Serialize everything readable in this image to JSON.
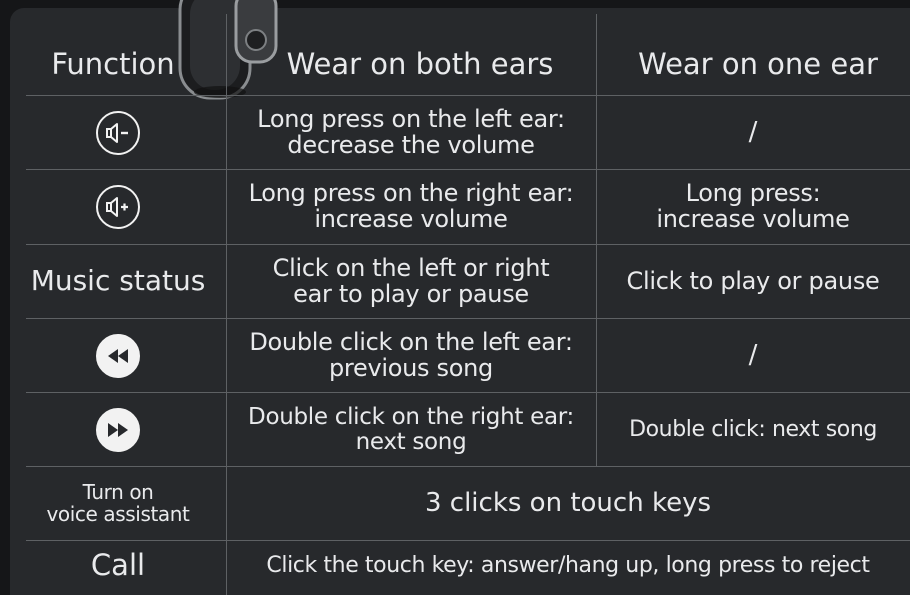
{
  "header": {
    "function": "Function",
    "both": "Wear on both ears",
    "one": "Wear on one ear"
  },
  "rows": [
    {
      "icon": "volume-down-icon",
      "both_line1": "Long press on the left ear:",
      "both_line2": "decrease the volume",
      "one": "/"
    },
    {
      "icon": "volume-up-icon",
      "both_line1": "Long press on the right ear:",
      "both_line2": "increase volume",
      "one_line1": "Long press:",
      "one_line2": "increase volume"
    },
    {
      "function": "Music status",
      "both_line1": "Click on the left or right",
      "both_line2": "ear to play or pause",
      "one": "Click to play or pause"
    },
    {
      "icon": "previous-song-icon",
      "both_line1": "Double click on the left ear:",
      "both_line2": "previous song",
      "one": "/"
    },
    {
      "icon": "next-song-icon",
      "both_line1": "Double click on the right ear:",
      "both_line2": "next song",
      "one": "Double click: next song"
    },
    {
      "function_line1": "Turn on",
      "function_line2": "voice assistant",
      "merged": "3 clicks on touch keys"
    },
    {
      "function": "Call",
      "merged": "Click the touch key: answer/hang up, long press to reject"
    }
  ],
  "colors": {
    "background": "#27292c",
    "text": "#e9eaec",
    "grid": "#5e6164"
  }
}
